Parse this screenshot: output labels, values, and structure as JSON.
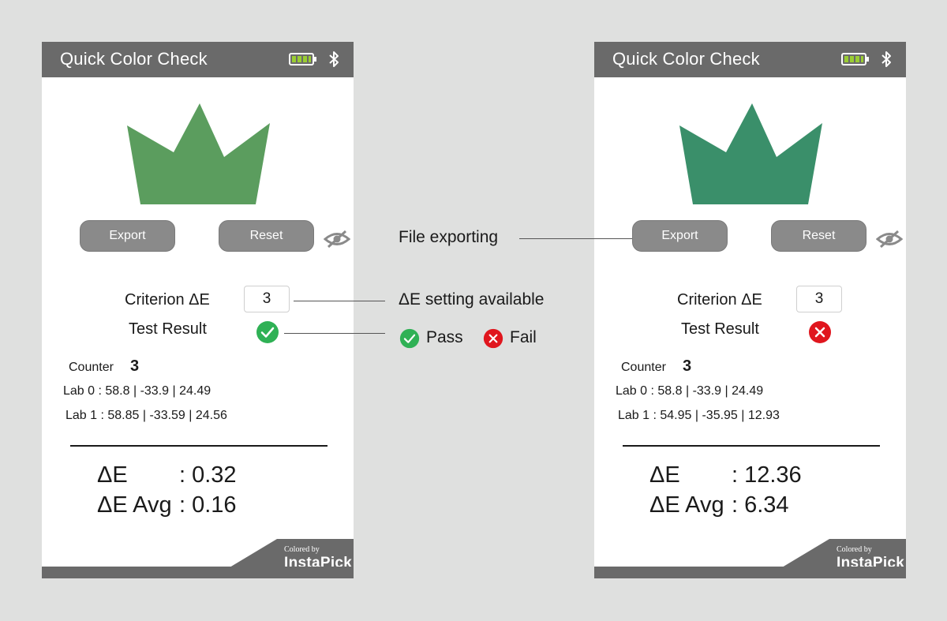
{
  "colors": {
    "pass": "#2fb155",
    "fail": "#e0161e",
    "crown_left": "#5b9d5e",
    "crown_right": "#3a8f6a",
    "titlebar": "#6a6a6a"
  },
  "screens": [
    {
      "title": "Quick Color Check",
      "export_label": "Export",
      "reset_label": "Reset",
      "criterion_label": "Criterion ΔE",
      "criterion_value": "3",
      "test_result_label": "Test Result",
      "test_result": "pass",
      "counter_label": "Counter",
      "counter_value": "3",
      "lab0": "Lab 0 : 58.8 | -33.9 | 24.49",
      "lab1": "Lab 1 : 58.85 | -33.59 | 24.56",
      "de_label": "ΔE",
      "de_value": ": 0.32",
      "de_avg_label": "ΔE Avg",
      "de_avg_value": ": 0.16",
      "brand_small": "Colored by",
      "brand_big": "InstaPick"
    },
    {
      "title": "Quick Color Check",
      "export_label": "Export",
      "reset_label": "Reset",
      "criterion_label": "Criterion ΔE",
      "criterion_value": "3",
      "test_result_label": "Test Result",
      "test_result": "fail",
      "counter_label": "Counter",
      "counter_value": "3",
      "lab0": "Lab 0 : 58.8 | -33.9 | 24.49",
      "lab1": "Lab 1 : 54.95 | -35.95 | 12.93",
      "de_label": "ΔE",
      "de_value": ": 12.36",
      "de_avg_label": "ΔE Avg",
      "de_avg_value": ": 6.34",
      "brand_small": "Colored by",
      "brand_big": "InstaPick"
    }
  ],
  "annotations": {
    "file_exporting": "File exporting",
    "de_setting": "ΔE setting available",
    "pass": "Pass",
    "fail": "Fail"
  }
}
